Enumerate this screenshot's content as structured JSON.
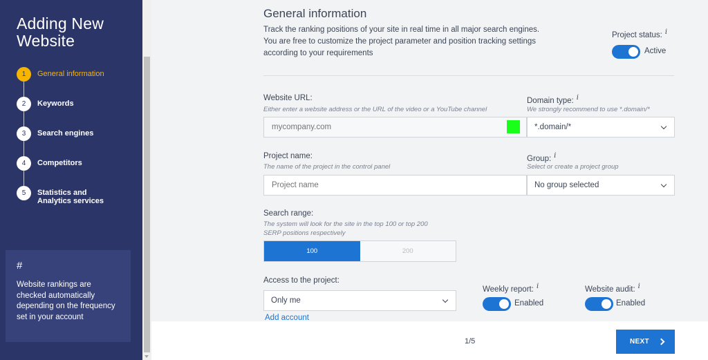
{
  "sidebar": {
    "title_line1": "Adding New",
    "title_line2": "Website",
    "steps": [
      {
        "num": "1",
        "label": "General information"
      },
      {
        "num": "2",
        "label": "Keywords"
      },
      {
        "num": "3",
        "label": "Search engines"
      },
      {
        "num": "4",
        "label": "Competitors"
      },
      {
        "num": "5",
        "label_line1": "Statistics and",
        "label_line2": "Analytics services"
      }
    ],
    "info": {
      "hash": "#",
      "text": "Website rankings are checked automatically depending on the frequency set in your account"
    }
  },
  "main": {
    "title": "General information",
    "description": "Track the ranking positions of your site in real time in all major search engines. You are free to customize the project parameter and position tracking settings according to your requirements",
    "project_status": {
      "label": "Project status:",
      "info": "i",
      "value": "Active"
    },
    "website_url": {
      "label": "Website URL:",
      "hint": "Either enter a website address or the URL of the video or a YouTube channel",
      "placeholder": "mycompany.com"
    },
    "domain_type": {
      "label": "Domain type:",
      "info": "i",
      "hint": "We strongly recommend to use *.domain/*",
      "value": "*.domain/*"
    },
    "project_name": {
      "label": "Project name:",
      "hint": "The name of the project in the control panel",
      "placeholder": "Project name"
    },
    "group": {
      "label": "Group:",
      "info": "i",
      "hint": "Select or create a project group",
      "value": "No group selected"
    },
    "search_range": {
      "label": "Search range:",
      "hint_line1": "The system will look for the site in the top 100 or top 200",
      "hint_line2": "SERP positions respectively",
      "options": [
        "100",
        "200"
      ]
    },
    "access": {
      "label": "Access to the project:",
      "value": "Only me",
      "link": "Add account"
    },
    "weekly_report": {
      "label": "Weekly report:",
      "info": "i",
      "value": "Enabled"
    },
    "website_audit": {
      "label": "Website audit:",
      "info": "i",
      "value": "Enabled"
    }
  },
  "footer": {
    "pager": "1/5",
    "next_label": "NEXT"
  },
  "colors": {
    "sidebar_bg": "#2b3567",
    "accent": "#1e74d3",
    "active_step": "#f7b500"
  }
}
